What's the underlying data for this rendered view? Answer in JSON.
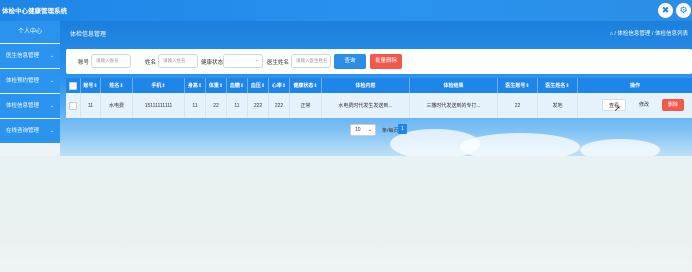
{
  "app": {
    "title": "体检中心健康管理系统",
    "header_icons": [
      "settings-icon",
      "logout-icon"
    ]
  },
  "sidebar": {
    "home_label": "个人中心",
    "items": [
      {
        "label": "医生信息管理"
      },
      {
        "label": "体检预约管理"
      },
      {
        "label": "体检信息管理"
      },
      {
        "label": "在线咨询管理"
      }
    ]
  },
  "breadcrumb": {
    "page_title": "体检信息管理",
    "path": "⌂ / 体检信息管理 / 体检信息列表"
  },
  "search": {
    "account_label": "账号",
    "account_placeholder": "请输入账号",
    "name_label": "姓名",
    "name_placeholder": "请输入姓名",
    "health_label": "健康状态",
    "health_value": "",
    "doctor_label": "医生姓名",
    "doctor_placeholder": "请输入医生姓名",
    "query_button": "查询",
    "batch_delete_button": "批量删除"
  },
  "table": {
    "headers": [
      "账号⇕",
      "姓名⇕",
      "手机⇕",
      "身高⇕",
      "体重⇕",
      "血糖⇕",
      "血压⇕",
      "心率⇕",
      "健康状态⇕",
      "体检内容",
      "体检结果",
      "医生账号⇕",
      "医生姓名⇕",
      "操作"
    ],
    "rows": [
      {
        "cells": [
          "11",
          "水电费",
          "15111111111",
          "11",
          "22",
          "11",
          "222",
          "222",
          "正常",
          "水电费时代发生发送到...",
          "三撒时代发送到的专打...",
          "22",
          "发地"
        ],
        "actions": {
          "view": "查看",
          "edit": "修改",
          "delete": "删除"
        }
      }
    ]
  },
  "pagination": {
    "page_size": "10",
    "page_size_suffix": "条/每页",
    "current_page": "1"
  },
  "colors": {
    "primary": "#1e86e8",
    "danger": "#f2594b",
    "row_bg": "#e6f2fc"
  }
}
